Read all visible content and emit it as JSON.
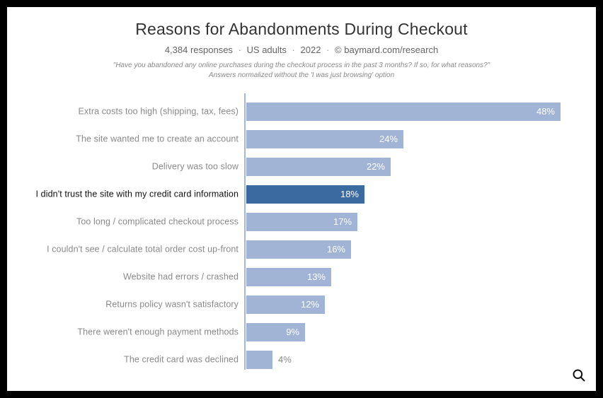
{
  "title": "Reasons for Abandonments During Checkout",
  "subtitle_parts": [
    "4,384 responses",
    "US adults",
    "2022",
    "©",
    "baymard.com/research"
  ],
  "question_line1": "\"Have you abandoned any online purchases during the checkout process in the past 3 months? If so, for what reasons?\"",
  "question_line2": "Answers normalized without the 'I was just browsing' option",
  "magnify_name": "magnify-icon",
  "chart_data": {
    "type": "bar",
    "orientation": "horizontal",
    "title": "Reasons for Abandonments During Checkout",
    "xlabel": "",
    "ylabel": "",
    "xlim": [
      0,
      50
    ],
    "categories": [
      "Extra costs too high (shipping, tax, fees)",
      "The site wanted me to create an account",
      "Delivery was too slow",
      "I didn't trust the site with my credit card information",
      "Too long / complicated checkout process",
      "I couldn't see / calculate total order cost up-front",
      "Website had errors / crashed",
      "Returns policy wasn't satisfactory",
      "There weren't enough payment methods",
      "The credit card was declined"
    ],
    "values": [
      48,
      24,
      22,
      18,
      17,
      16,
      13,
      12,
      9,
      4
    ],
    "value_labels": [
      "48%",
      "24%",
      "22%",
      "18%",
      "17%",
      "16%",
      "13%",
      "12%",
      "9%",
      "4%"
    ],
    "highlighted_index": 3,
    "colors": {
      "default": "#a1b4d5",
      "highlight": "#3b6aa0"
    }
  }
}
